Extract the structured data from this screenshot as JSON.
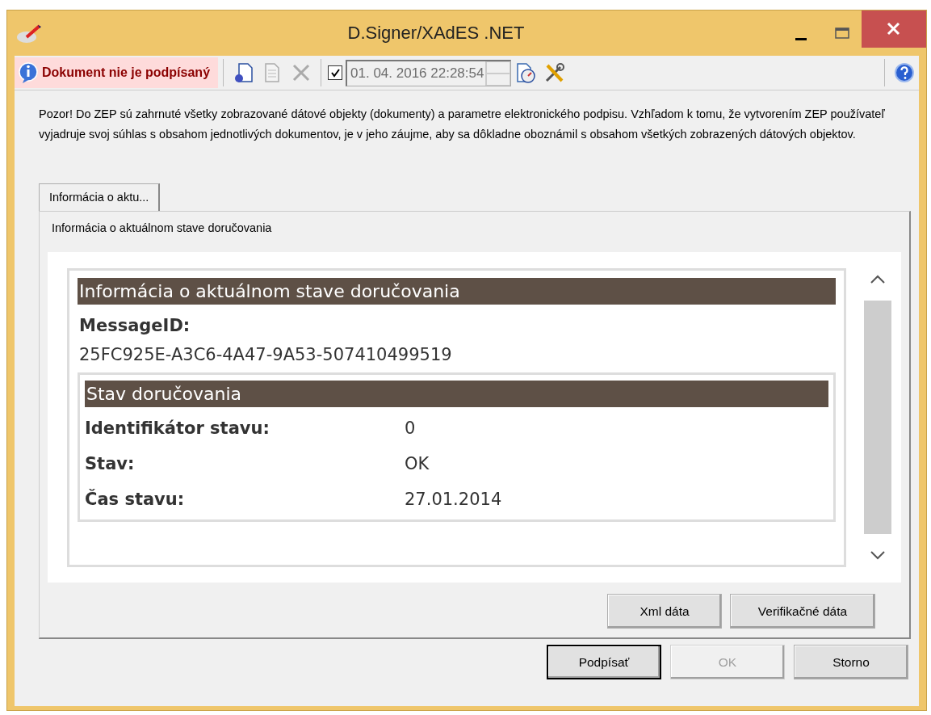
{
  "window": {
    "title": "D.Signer/XAdES .NET"
  },
  "toolbar": {
    "status": "Dokument nie je podpísaný",
    "timestamp_enabled": true,
    "timestamp": "01. 04. 2016 22:28:54"
  },
  "notice": "Pozor! Do ZEP sú zahrnuté všetky zobrazované dátové objekty (dokumenty) a parametre elektronického podpisu. Vzhľadom k tomu, že vytvorením ZEP používateľ vyjadruje svoj súhlas s obsahom jednotlivých dokumentov, je v jeho záujme, aby sa dôkladne oboznámil s obsahom všetkých zobrazených dátových objektov.",
  "tabs": [
    {
      "label": "Informácia o aktu...",
      "selected": true
    }
  ],
  "panel": {
    "caption": "Informácia o aktuálnom stave doručovania",
    "document": {
      "heading": "Informácia o aktuálnom stave doručovania",
      "label": "MessageID:",
      "value": "25FC925E-A3C6-4A47-9A53-507410499519",
      "section": {
        "heading": "Stav doručovania",
        "rows": [
          {
            "label": "Identifikátor stavu:",
            "value": "0"
          },
          {
            "label": "Stav:",
            "value": "OK"
          },
          {
            "label": "Čas stavu:",
            "value": "27.01.2014"
          }
        ]
      }
    }
  },
  "panel_buttons": [
    {
      "label": "Xml dáta"
    },
    {
      "label": "Verifikačné dáta"
    }
  ],
  "buttons": [
    {
      "label": "Podpísať",
      "default": true,
      "disabled": false
    },
    {
      "label": "OK",
      "default": false,
      "disabled": true
    },
    {
      "label": "Storno",
      "default": false,
      "disabled": false
    }
  ]
}
